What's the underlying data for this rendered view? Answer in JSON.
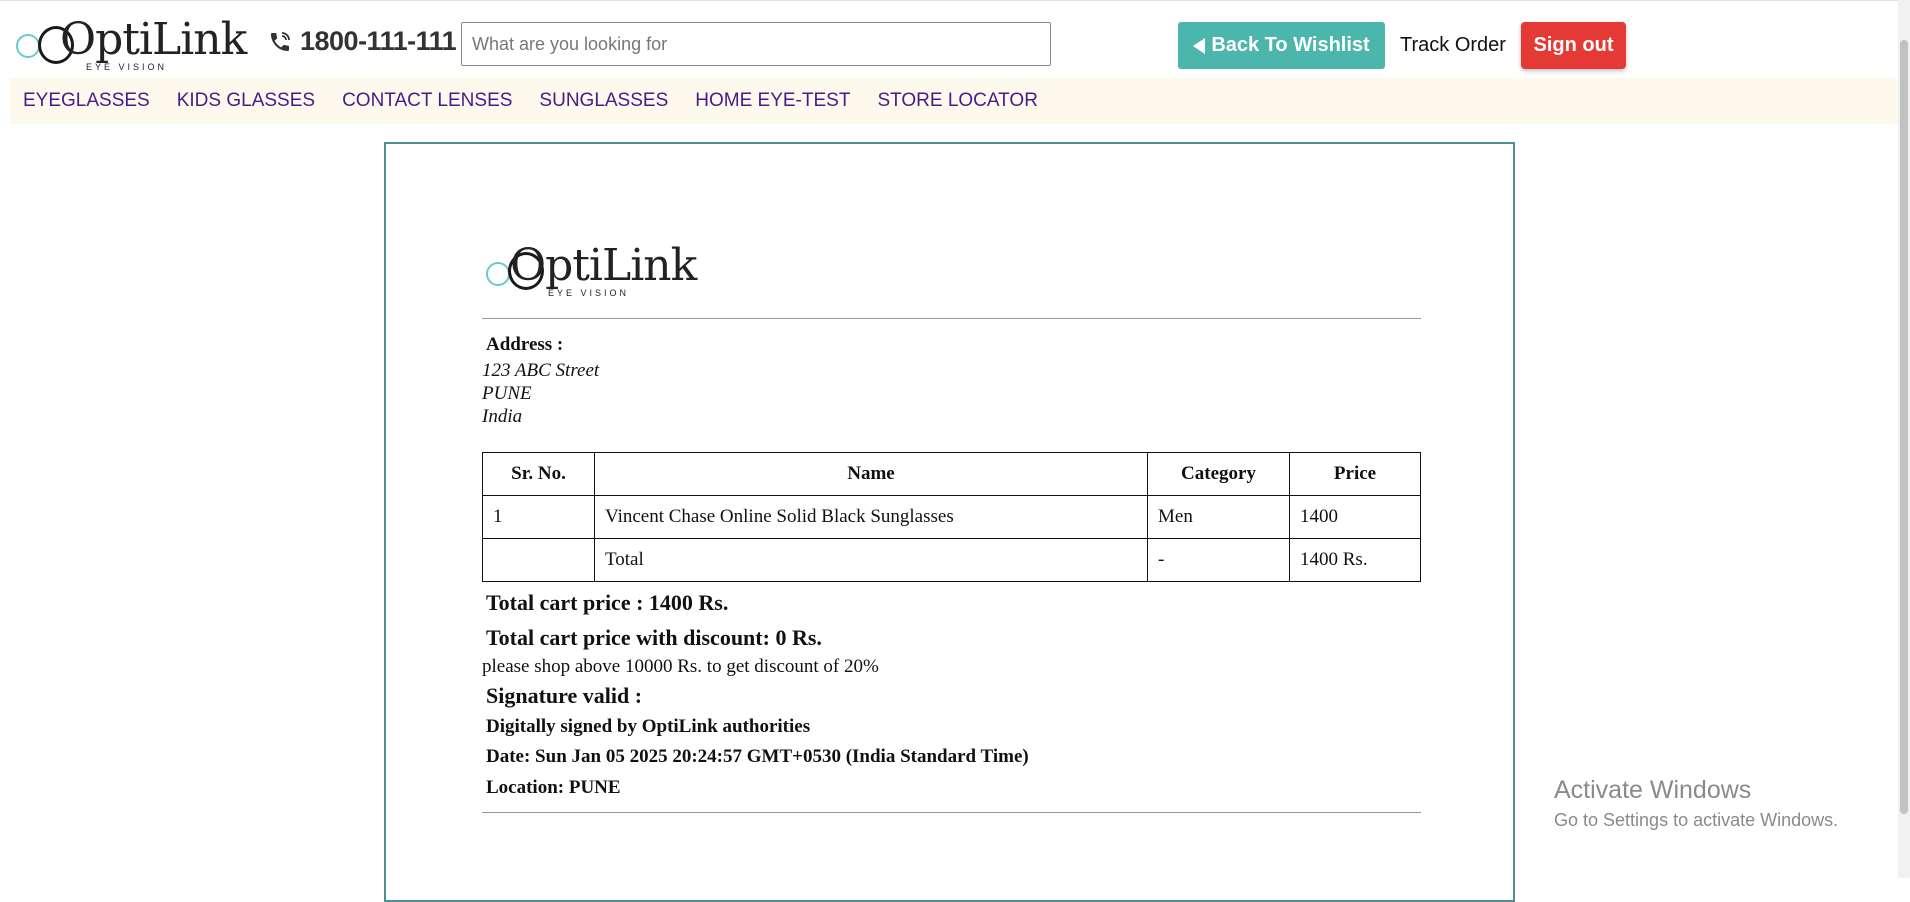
{
  "header": {
    "brand": "OptiLink",
    "brand_sub": "EYE VISION",
    "phone": "1800-111-111",
    "search_placeholder": "What are you looking for",
    "back_label": "Back To Wishlist",
    "track_label": "Track Order",
    "signout_label": "Sign out"
  },
  "nav": [
    {
      "label": "EYEGLASSES"
    },
    {
      "label": "KIDS GLASSES"
    },
    {
      "label": "CONTACT LENSES"
    },
    {
      "label": "SUNGLASSES"
    },
    {
      "label": "HOME EYE-TEST"
    },
    {
      "label": "STORE LOCATOR"
    }
  ],
  "invoice": {
    "brand": "OptiLink",
    "brand_sub": "EYE VISION",
    "address_label": "Address :",
    "address_lines": [
      "123 ABC Street",
      "PUNE",
      "India"
    ],
    "table": {
      "headers": [
        "Sr. No.",
        "Name",
        "Category",
        "Price"
      ],
      "rows": [
        [
          "1",
          "Vincent Chase Online Solid Black Sunglasses",
          "Men",
          "1400"
        ],
        [
          "",
          "Total",
          "-",
          "1400 Rs."
        ]
      ]
    },
    "total_price": "Total cart price : 1400 Rs.",
    "total_discount": "Total cart price with discount: 0 Rs.",
    "discount_note": "please shop above 10000 Rs. to get discount of 20%",
    "signature_label": "Signature valid :",
    "signed_by": "Digitally signed by OptiLink authorities",
    "date": "Date: Sun Jan 05 2025 20:24:57 GMT+0530 (India Standard Time)",
    "location": "Location: PUNE"
  },
  "watermark": {
    "title": "Activate Windows",
    "subtitle": "Go to Settings to activate Windows."
  },
  "colors": {
    "teal": "#4db6ac",
    "red": "#e53935",
    "nav_text": "#4a1a8a",
    "nav_bg": "#fdf9ec",
    "paper_border": "#4e8f99"
  },
  "icons": {
    "phone": "phone-icon",
    "back": "triangle-left-icon"
  }
}
